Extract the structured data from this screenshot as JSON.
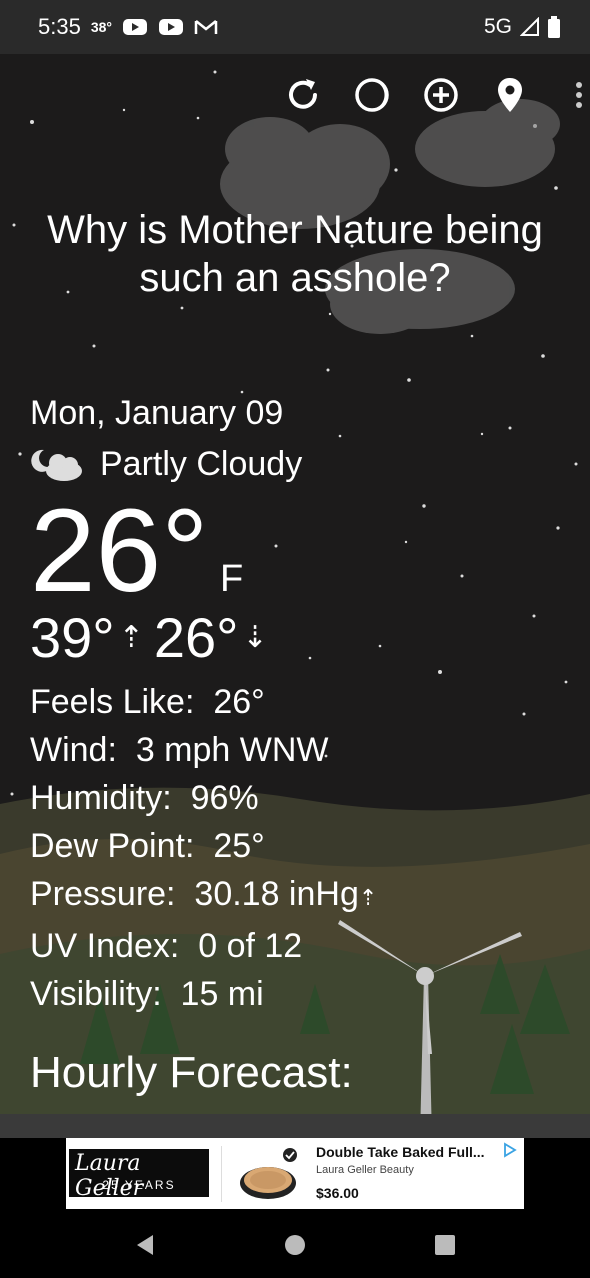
{
  "status_bar": {
    "time": "5:35",
    "temperature": "38°",
    "network": "5G"
  },
  "toolbar": {
    "icons": [
      "refresh-icon",
      "moon-phase-icon",
      "add-location-icon",
      "location-pin-icon",
      "more-options-icon"
    ]
  },
  "quote": "Why is Mother Nature being such an asshole?",
  "weather": {
    "date": "Mon, January 09",
    "condition": "Partly Cloudy",
    "temperature": "26°",
    "unit": "F",
    "high": "39°",
    "low": "26°",
    "details": [
      {
        "label": "Feels Like:",
        "value": "26°"
      },
      {
        "label": "Wind:",
        "value": "3 mph WNW"
      },
      {
        "label": "Humidity:",
        "value": "96%"
      },
      {
        "label": "Dew Point:",
        "value": "25°"
      },
      {
        "label": "Pressure:",
        "value": "30.18 inHg"
      },
      {
        "label": "UV Index:",
        "value": "0 of 12"
      },
      {
        "label": "Visibility:",
        "value": "15 mi"
      }
    ],
    "hourly_heading": "Hourly Forecast:"
  },
  "ad": {
    "logo_text": "Laura Geller",
    "logo_subtext": "25 YEARS",
    "title": "Double Take Baked Full...",
    "brand": "Laura Geller Beauty",
    "price": "$36.00"
  },
  "colors": {
    "status_bar_bg": "#2a2a2a",
    "sky": "#1c1b1b",
    "ground": "#3d3a28"
  }
}
